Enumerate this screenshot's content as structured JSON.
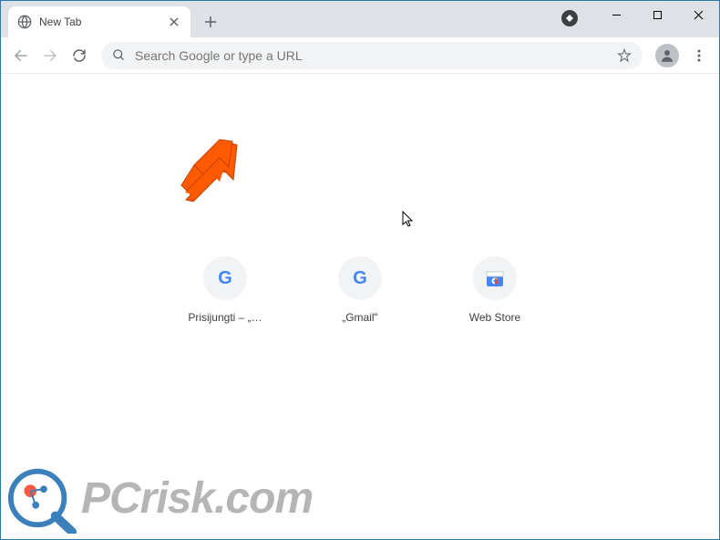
{
  "tab": {
    "title": "New Tab"
  },
  "omnibox": {
    "placeholder": "Search Google or type a URL"
  },
  "shortcuts": [
    {
      "label": "Prisijungti – „…",
      "icon": "google"
    },
    {
      "label": "„Gmail\"",
      "icon": "google"
    },
    {
      "label": "Web Store",
      "icon": "webstore"
    }
  ],
  "watermark": {
    "text": "PCrisk.com"
  }
}
